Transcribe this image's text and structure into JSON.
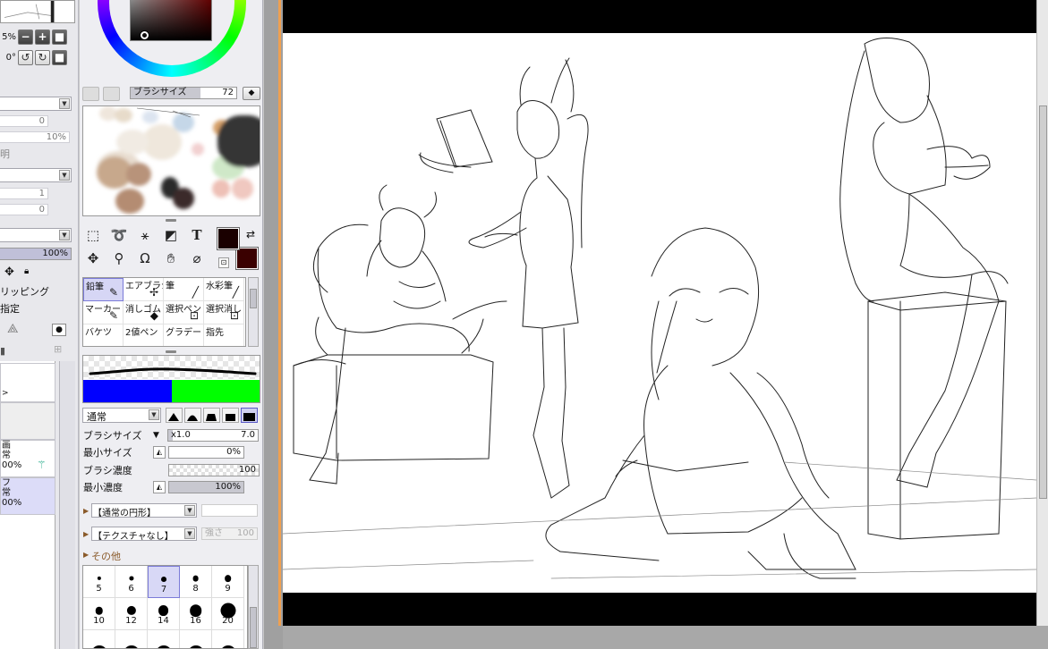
{
  "layer_panel": {
    "zoom_value": "5%",
    "rotation_value": "0°",
    "zoom_buttons": [
      "−",
      "+",
      "■"
    ],
    "rotate_buttons": [
      "↺",
      "↻",
      "■"
    ],
    "field_values": [
      "0",
      "10%",
      "1",
      "0"
    ],
    "partial_label": "明",
    "opacity_value": "100%",
    "clipping_label": "リッピング",
    "select_source_label": "指定",
    "layer_items": [
      {
        "name": "",
        "mode": "",
        "opacity": ""
      },
      {
        "name": "画",
        "mode": "常",
        "opacity": "00%"
      },
      {
        "name": "フ",
        "mode": "常",
        "opacity": "00%"
      }
    ]
  },
  "tool_panel": {
    "brush_size_top": {
      "label": "ブラシサイズ",
      "value": "72"
    },
    "tools": [
      "rect-select-icon",
      "lasso-icon",
      "magic-wand-icon",
      "fill-bucket-icon",
      "text-tool-icon",
      "move-icon",
      "zoom-icon",
      "rotate-icon",
      "hand-icon",
      "eyedropper-icon"
    ],
    "brushes": [
      {
        "label": "鉛筆",
        "icon": "✎",
        "selected": true
      },
      {
        "label": "エアブラシ",
        "icon": "✢",
        "selected": false
      },
      {
        "label": "筆",
        "icon": "╱",
        "selected": false
      },
      {
        "label": "水彩筆",
        "icon": "╱",
        "selected": false
      },
      {
        "label": "マーカー",
        "icon": "✎",
        "selected": false
      },
      {
        "label": "消しゴム",
        "icon": "◆",
        "selected": false
      },
      {
        "label": "選択ペン",
        "icon": "⊡",
        "selected": false
      },
      {
        "label": "選択消し",
        "icon": "⊡",
        "selected": false
      },
      {
        "label": "バケツ",
        "icon": "",
        "selected": false
      },
      {
        "label": "2値ペン",
        "icon": "",
        "selected": false
      },
      {
        "label": "グラデー",
        "icon": "",
        "selected": false
      },
      {
        "label": "指先",
        "icon": "",
        "selected": false
      }
    ],
    "blend_mode": "通常",
    "props": {
      "size_label": "ブラシサイズ",
      "size_multiplier": "x1.0",
      "size_value": "7.0",
      "min_size_label": "最小サイズ",
      "min_size_value": "0%",
      "density_label": "ブラシ濃度",
      "density_value": "100",
      "min_density_label": "最小濃度",
      "min_density_value": "100%"
    },
    "shape_select": "【通常の円形】",
    "texture_select": "【テクスチャなし】",
    "texture_strength_label": "強さ",
    "texture_strength_value": "100",
    "other_label": "その他",
    "tips": [
      {
        "size": "5",
        "selected": false
      },
      {
        "size": "6",
        "selected": false
      },
      {
        "size": "7",
        "selected": true
      },
      {
        "size": "8",
        "selected": false
      },
      {
        "size": "9",
        "selected": false
      },
      {
        "size": "10",
        "selected": false
      },
      {
        "size": "12",
        "selected": false
      },
      {
        "size": "14",
        "selected": false
      },
      {
        "size": "16",
        "selected": false
      },
      {
        "size": "20",
        "selected": false
      },
      {
        "size": "",
        "selected": false
      },
      {
        "size": "",
        "selected": false
      },
      {
        "size": "",
        "selected": false
      },
      {
        "size": "",
        "selected": false
      },
      {
        "size": "",
        "selected": false
      }
    ],
    "primary_color": "#1a0000",
    "secondary_color": "#3a0000"
  },
  "canvas": {
    "stroke_colors": [
      "#0000ff",
      "#00ff00"
    ]
  }
}
